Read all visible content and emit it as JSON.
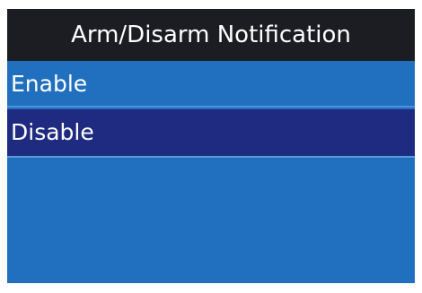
{
  "screen": {
    "title": "Arm/Disarm Notification",
    "items": [
      {
        "label": "Enable",
        "selected": false
      },
      {
        "label": "Disable",
        "selected": true
      }
    ]
  },
  "colors": {
    "title_background": "#1c1d22",
    "menu_background": "#2170c0",
    "selected_background": "#1f2b80",
    "text": "#ffffff"
  }
}
